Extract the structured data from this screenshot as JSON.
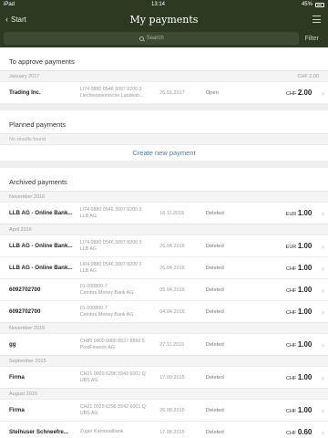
{
  "statusbar": {
    "device": "iPad",
    "time": "13:14",
    "battery": "45%"
  },
  "nav": {
    "back_label": "Start",
    "title": "My payments"
  },
  "search": {
    "placeholder": "Search",
    "filter_label": "Filter"
  },
  "to_approve": {
    "title": "To approve payments",
    "group": {
      "label": "January 2017",
      "total": "CHF 2.00"
    },
    "rows": [
      {
        "name": "Trading Inc.",
        "acct1": "LI74 0880 0546 3097 8200 3",
        "acct2": "Liechtensteinische Landesb...",
        "date": "26.01.2017",
        "status": "Open",
        "currency": "CHF",
        "amount": "2.00"
      }
    ]
  },
  "planned": {
    "title": "Planned payments",
    "no_results": "No results found",
    "create_label": "Create new payment"
  },
  "archived": {
    "title": "Archived payments",
    "groups": [
      {
        "label": "November 2016",
        "rows": [
          {
            "name": "LLB AG - Online Bank...",
            "acct1": "LI74 0880 0546 3097 8200 3",
            "acct2": "LLB AG",
            "date": "16.11.2016",
            "status": "Deleted",
            "currency": "EUR",
            "amount": "1.00"
          }
        ]
      },
      {
        "label": "April 2016",
        "rows": [
          {
            "name": "LLB AG - Online Bank...",
            "acct1": "LI74 0880 0546 3097 8200 3",
            "acct2": "LLB AG",
            "date": "26.04.2016",
            "status": "Deleted",
            "currency": "EUR",
            "amount": "1.00"
          },
          {
            "name": "LLB AG - Online Bank...",
            "acct1": "LI04 0880 0546 3097 8200 2",
            "acct2": "LLB AG",
            "date": "26.04.2016",
            "status": "Deleted",
            "currency": "CHF",
            "amount": "1.00"
          },
          {
            "name": "6092702700",
            "acct1": "01-000800-7",
            "acct2": "Cembra Money Bank AG",
            "date": "05.04.2016",
            "status": "Deleted",
            "currency": "CHF",
            "amount": "1.00"
          },
          {
            "name": "6092702700",
            "acct1": "01-000800-7",
            "acct2": "Cembra Money Bank AG",
            "date": "04.04.2016",
            "status": "Deleted",
            "currency": "CHF",
            "amount": "1.00"
          }
        ]
      },
      {
        "label": "November 2015",
        "rows": [
          {
            "name": "gg",
            "acct1": "CH85 0900 0000 8537 8650 5",
            "acct2": "PostFinance AG",
            "date": "27.11.2015",
            "status": "Deleted",
            "currency": "CHF",
            "amount": "1.00"
          }
        ]
      },
      {
        "label": "September 2015",
        "rows": [
          {
            "name": "Firma",
            "acct1": "CH21 0029 6296 5542 6001 Q",
            "acct2": "UBS AG",
            "date": "17.09.2015",
            "status": "Deleted",
            "currency": "CHF",
            "amount": "1.00"
          }
        ]
      },
      {
        "label": "August 2015",
        "rows": [
          {
            "name": "Firma",
            "acct1": "CH21 0029 6296 5542 6001 Q",
            "acct2": "UBS AG",
            "date": "26.08.2015",
            "status": "Deleted",
            "currency": "CHF",
            "amount": "1.00"
          },
          {
            "name": "Steihuser Schneefre...",
            "acct1": "Zuger Kantonalbank",
            "acct2": "",
            "date": "17.08.2015",
            "status": "Deleted",
            "currency": "CHF",
            "amount": "0.60"
          }
        ]
      }
    ]
  },
  "icons": {
    "back": "chevron-left-icon",
    "menu": "hamburger-menu-icon",
    "search": "search-icon",
    "row": "chevron-right-icon"
  },
  "colors": {
    "header_bg": "#2d3a22",
    "link": "#4a7da8"
  }
}
